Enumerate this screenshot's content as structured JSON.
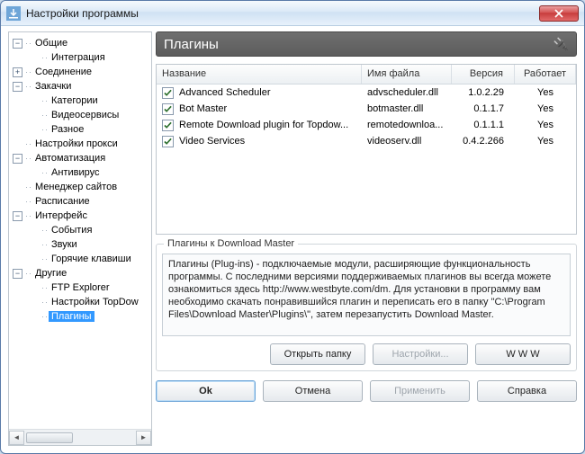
{
  "window": {
    "title": "Настройки программы"
  },
  "sidebar": {
    "nodes": [
      {
        "label": "Общие",
        "depth": 0,
        "expand": "−"
      },
      {
        "label": "Интеграция",
        "depth": 1
      },
      {
        "label": "Соединение",
        "depth": 0,
        "expand": "+"
      },
      {
        "label": "Закачки",
        "depth": 0,
        "expand": "−"
      },
      {
        "label": "Категории",
        "depth": 1
      },
      {
        "label": "Видеосервисы",
        "depth": 1
      },
      {
        "label": "Разное",
        "depth": 1
      },
      {
        "label": "Настройки прокси",
        "depth": 0
      },
      {
        "label": "Автоматизация",
        "depth": 0,
        "expand": "−"
      },
      {
        "label": "Антивирус",
        "depth": 1
      },
      {
        "label": "Менеджер сайтов",
        "depth": 0
      },
      {
        "label": "Расписание",
        "depth": 0
      },
      {
        "label": "Интерфейс",
        "depth": 0,
        "expand": "−"
      },
      {
        "label": "События",
        "depth": 1
      },
      {
        "label": "Звуки",
        "depth": 1
      },
      {
        "label": "Горячие клавиши",
        "depth": 1
      },
      {
        "label": "Другие",
        "depth": 0,
        "expand": "−"
      },
      {
        "label": "FTP Explorer",
        "depth": 1
      },
      {
        "label": "Настройки TopDow",
        "depth": 1
      },
      {
        "label": "Плагины",
        "depth": 1,
        "selected": true
      }
    ]
  },
  "panel": {
    "title": "Плагины"
  },
  "table": {
    "headers": {
      "name": "Название",
      "file": "Имя файла",
      "version": "Версия",
      "works": "Работает"
    },
    "rows": [
      {
        "name": "Advanced Scheduler",
        "file": "advscheduler.dll",
        "version": "1.0.2.29",
        "works": "Yes",
        "checked": true
      },
      {
        "name": "Bot Master",
        "file": "botmaster.dll",
        "version": "0.1.1.7",
        "works": "Yes",
        "checked": true
      },
      {
        "name": "Remote Download plugin for Topdow...",
        "file": "remotedownloa...",
        "version": "0.1.1.1",
        "works": "Yes",
        "checked": true
      },
      {
        "name": "Video Services",
        "file": "videoserv.dll",
        "version": "0.4.2.266",
        "works": "Yes",
        "checked": true
      }
    ]
  },
  "group": {
    "title": "Плагины к Download Master",
    "description": "Плагины (Plug-ins) - подключаемые модули, расширяющие функциональность программы. С последними версиями поддерживаемых плагинов вы всегда можете ознакомиться здесь http://www.westbyte.com/dm. Для установки в программу вам необходимо скачать понравившийся плагин и переписать его в папку \"C:\\Program Files\\Download Master\\Plugins\\\", затем перезапустить Download Master.",
    "buttons": {
      "open": "Открыть папку",
      "settings": "Настройки...",
      "www": "W W W"
    }
  },
  "footer": {
    "ok": "Ok",
    "cancel": "Отмена",
    "apply": "Применить",
    "help": "Справка"
  }
}
